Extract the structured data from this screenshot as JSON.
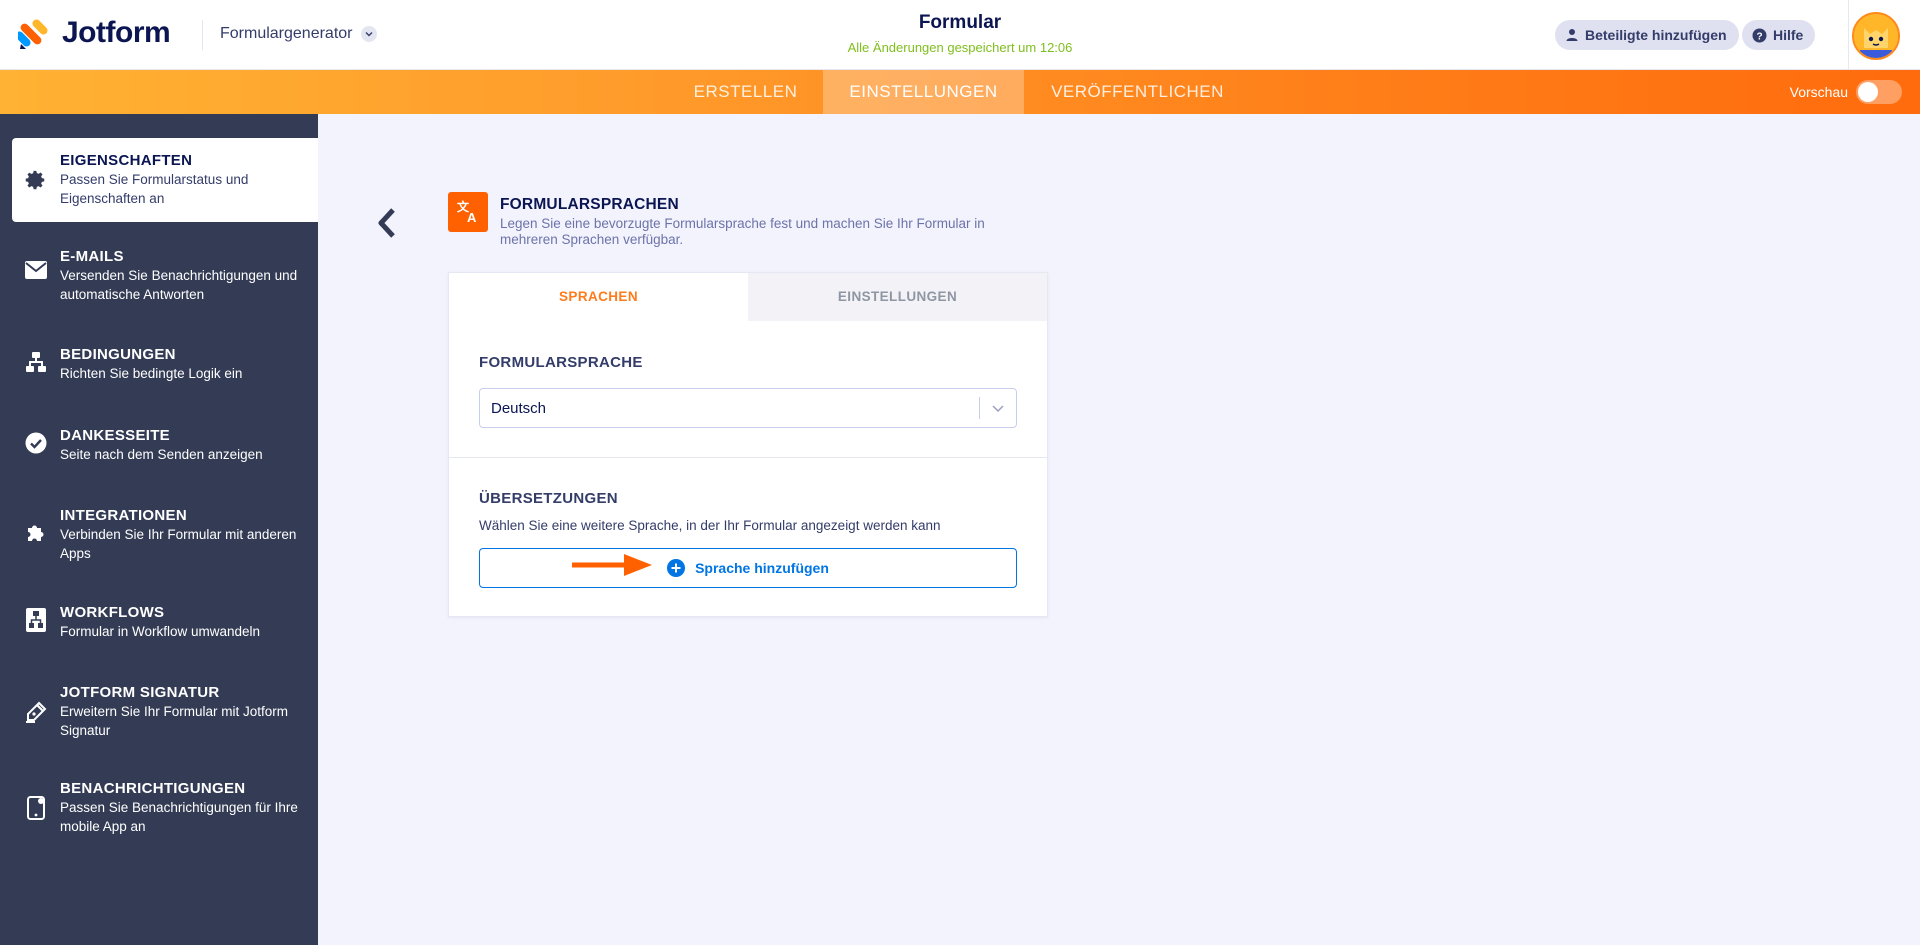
{
  "header": {
    "logo_text": "Jotform",
    "builder_label": "Formulargenerator",
    "form_title": "Formular",
    "save_status": "Alle Änderungen gespeichert um 12:06",
    "collaborators_label": "Beteiligte hinzufügen",
    "help_label": "Hilfe",
    "avatar": "avatar-icon"
  },
  "navbar": {
    "tabs": [
      {
        "label": "ERSTELLEN",
        "active": false
      },
      {
        "label": "EINSTELLUNGEN",
        "active": true
      },
      {
        "label": "VERÖFFENTLICHEN",
        "active": false
      }
    ],
    "preview_label": "Vorschau",
    "preview_on": false
  },
  "sidebar": {
    "items": [
      {
        "title": "EIGENSCHAFTEN",
        "desc": "Passen Sie Formularstatus und Eigenschaften an",
        "icon": "gear-icon",
        "active": true
      },
      {
        "title": "E-MAILS",
        "desc": "Versenden Sie Benachrichtigungen und automatische Antworten",
        "icon": "envelope-icon",
        "active": false
      },
      {
        "title": "BEDINGUNGEN",
        "desc": "Richten Sie bedingte Logik ein",
        "icon": "sitemap-icon",
        "active": false
      },
      {
        "title": "DANKESSEITE",
        "desc": "Seite nach dem Senden anzeigen",
        "icon": "check-circle-icon",
        "active": false
      },
      {
        "title": "INTEGRATIONEN",
        "desc": "Verbinden Sie Ihr Formular mit anderen Apps",
        "icon": "puzzle-icon",
        "active": false
      },
      {
        "title": "WORKFLOWS",
        "desc": "Formular in Workflow umwandeln",
        "icon": "workflow-icon",
        "active": false
      },
      {
        "title": "JOTFORM SIGNATUR",
        "desc": "Erweitern Sie Ihr Formular mit Jotform Signatur",
        "icon": "pen-icon",
        "active": false
      },
      {
        "title": "BENACHRICHTIGUNGEN",
        "desc": "Passen Sie Benachrichtigungen für Ihre mobile App an",
        "icon": "mobile-icon",
        "active": false
      }
    ]
  },
  "section": {
    "icon": "translate-icon",
    "title": "FORMULARSPRACHEN",
    "desc": "Legen Sie eine bevorzugte Formularsprache fest und machen Sie Ihr Formular in mehreren Sprachen verfügbar."
  },
  "card": {
    "tabs": [
      {
        "label": "SPRACHEN",
        "active": true
      },
      {
        "label": "EINSTELLUNGEN",
        "active": false
      }
    ],
    "form_language_label": "FORMULARSPRACHE",
    "form_language_value": "Deutsch",
    "translations_label": "ÜBERSETZUNGEN",
    "translations_desc": "Wählen Sie eine weitere Sprache, in der Ihr Formular angezeigt werden kann",
    "add_language_label": "Sprache hinzufügen"
  },
  "colors": {
    "accent_orange": "#ff6100",
    "sidebar_bg": "#343c55",
    "link_blue": "#0075e3",
    "success_green": "#7fbf1d"
  }
}
